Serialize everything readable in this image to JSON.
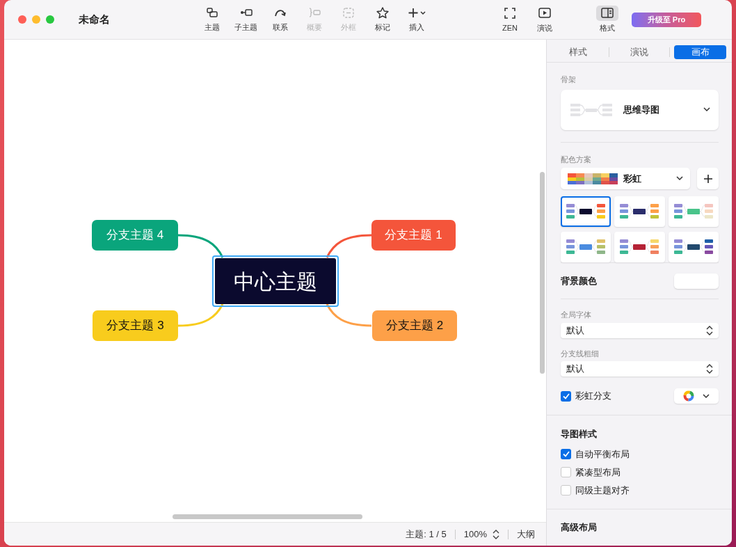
{
  "window": {
    "title": "未命名"
  },
  "toolbar": [
    {
      "kind": "topic",
      "label": "主题",
      "disabled": false
    },
    {
      "kind": "subtopic",
      "label": "子主题",
      "disabled": false
    },
    {
      "kind": "relation",
      "label": "联系",
      "disabled": false
    },
    {
      "kind": "summary",
      "label": "概要",
      "disabled": true
    },
    {
      "kind": "boundary",
      "label": "外框",
      "disabled": true
    },
    {
      "kind": "marker",
      "label": "标记",
      "disabled": false
    },
    {
      "kind": "insert",
      "label": "插入",
      "disabled": false
    }
  ],
  "toolbar_right": [
    {
      "kind": "zen",
      "label": "ZEN",
      "selected": false
    },
    {
      "kind": "pitch",
      "label": "演说",
      "selected": false
    },
    {
      "kind": "format",
      "label": "格式",
      "selected": true
    }
  ],
  "upgrade_button": "升级至 Pro",
  "map": {
    "central": {
      "label": "中心主题",
      "selected": true
    },
    "branches": [
      {
        "label": "分支主题 4",
        "color": "#0aa57c"
      },
      {
        "label": "分支主题 1",
        "color": "#f4553b"
      },
      {
        "label": "分支主题 3",
        "color": "#f8cc1d"
      },
      {
        "label": "分支主题 2",
        "color": "#fda048"
      }
    ]
  },
  "status_bar": {
    "topics": "主题: 1 / 5",
    "zoom": "100%",
    "outline": "大纲"
  },
  "panel": {
    "tabs": [
      {
        "label": "样式",
        "selected": false
      },
      {
        "label": "演说",
        "selected": false
      },
      {
        "label": "画布",
        "selected": true
      }
    ],
    "skeleton": {
      "label": "骨架",
      "value": "思维导图"
    },
    "color_scheme": {
      "label": "配色方案",
      "value": "彩虹",
      "themes": [
        {
          "selected": true
        },
        {
          "selected": false
        },
        {
          "selected": false
        },
        {
          "selected": false
        },
        {
          "selected": false
        },
        {
          "selected": false
        }
      ]
    },
    "background": {
      "label": "背景颜色"
    },
    "font": {
      "label": "全局字体",
      "value": "默认"
    },
    "line_width": {
      "label": "分支线粗细",
      "value": "默认"
    },
    "rainbow_branch": {
      "label": "彩虹分支",
      "checked": true
    },
    "map_style": {
      "label": "导图样式",
      "options": [
        {
          "label": "自动平衡布局",
          "checked": true
        },
        {
          "label": "紧凑型布局",
          "checked": false
        },
        {
          "label": "同级主题对齐",
          "checked": false
        }
      ]
    },
    "advanced": {
      "label": "高级布局"
    }
  }
}
